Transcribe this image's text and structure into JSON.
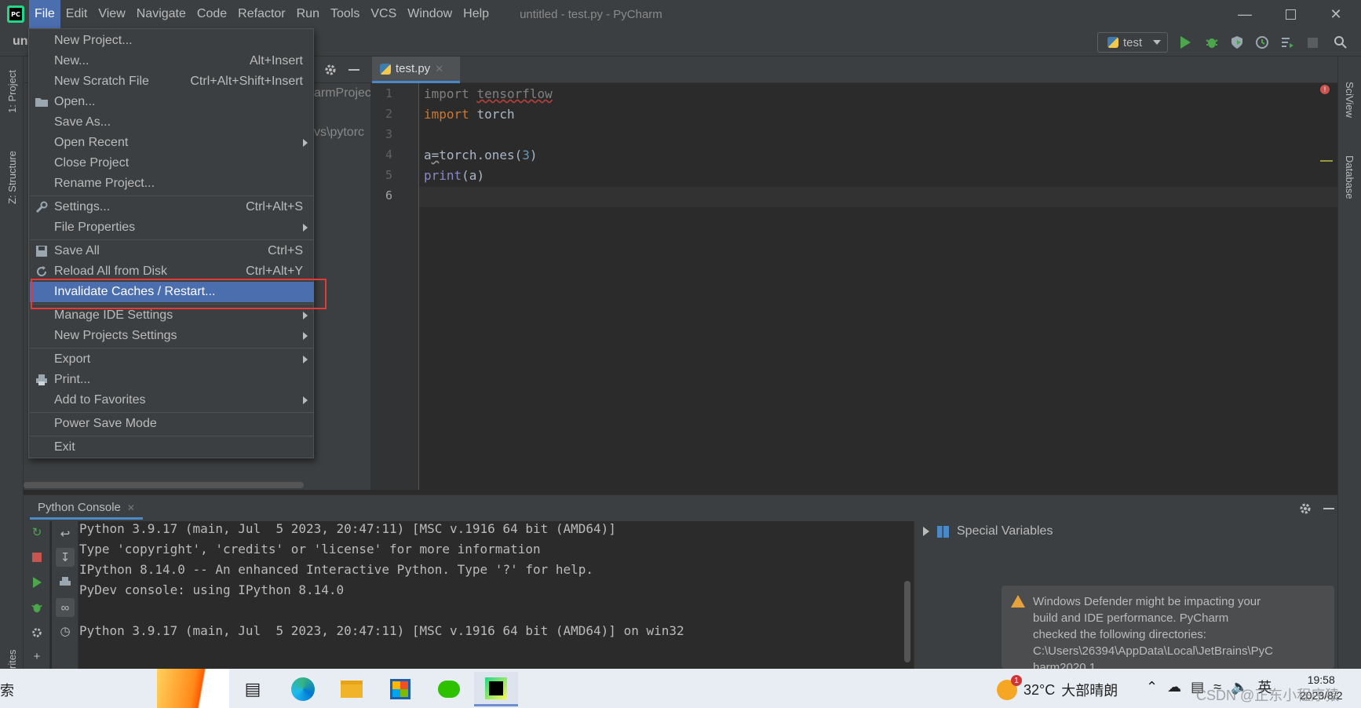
{
  "menubar": {
    "items": [
      "File",
      "Edit",
      "View",
      "Navigate",
      "Code",
      "Refactor",
      "Run",
      "Tools",
      "VCS",
      "Window",
      "Help"
    ],
    "window_title": "untitled - test.py - PyCharm"
  },
  "navbar": {
    "project_crumb": "unt",
    "run_config": "test"
  },
  "left_strip": {
    "project_tab": "1: Project",
    "structure_tab": "Z: Structure",
    "favorites_tab": "rites"
  },
  "right_strip": {
    "sciview_tab": "SciView",
    "database_tab": "Database"
  },
  "project_pane": {
    "row1_partial": "armProjec",
    "row2_partial": "vs\\pytorc"
  },
  "editor": {
    "tab_label": "test.py",
    "line_numbers": [
      "1",
      "2",
      "3",
      "4",
      "5",
      "6"
    ],
    "lines": {
      "l1_kw": "import",
      "l1_mod": "tensorflow",
      "l2_kw": "import",
      "l2_mod": "torch",
      "l4_pre": "a",
      "l4_eq": "=",
      "l4_mid": "torch.ones(",
      "l4_num": "3",
      "l4_end": ")",
      "l5_fn": "print",
      "l5_arg": "(a)"
    }
  },
  "file_menu": {
    "items": [
      {
        "label": "New Project...",
        "shortcut": ""
      },
      {
        "label": "New...",
        "shortcut": "Alt+Insert"
      },
      {
        "label": "New Scratch File",
        "shortcut": "Ctrl+Alt+Shift+Insert"
      },
      {
        "label": "Open...",
        "shortcut": ""
      },
      {
        "label": "Save As...",
        "shortcut": ""
      },
      {
        "label": "Open Recent",
        "shortcut": ""
      },
      {
        "label": "Close Project",
        "shortcut": ""
      },
      {
        "label": "Rename Project...",
        "shortcut": ""
      },
      {
        "label": "Settings...",
        "shortcut": "Ctrl+Alt+S"
      },
      {
        "label": "File Properties",
        "shortcut": ""
      },
      {
        "label": "Save All",
        "shortcut": "Ctrl+S"
      },
      {
        "label": "Reload All from Disk",
        "shortcut": "Ctrl+Alt+Y"
      },
      {
        "label": "Invalidate Caches / Restart...",
        "shortcut": ""
      },
      {
        "label": "Manage IDE Settings",
        "shortcut": ""
      },
      {
        "label": "New Projects Settings",
        "shortcut": ""
      },
      {
        "label": "Export",
        "shortcut": ""
      },
      {
        "label": "Print...",
        "shortcut": ""
      },
      {
        "label": "Add to Favorites",
        "shortcut": ""
      },
      {
        "label": "Power Save Mode",
        "shortcut": ""
      },
      {
        "label": "Exit",
        "shortcut": ""
      }
    ]
  },
  "console": {
    "tab_label": "Python Console",
    "lines": [
      "Python 3.9.17 (main, Jul  5 2023, 20:47:11) [MSC v.1916 64 bit (AMD64)]",
      "Type 'copyright', 'credits' or 'license' for more information",
      "IPython 8.14.0 -- An enhanced Interactive Python. Type '?' for help.",
      "PyDev console: using IPython 8.14.0",
      "Python 3.9.17 (main, Jul  5 2023, 20:47:11) [MSC v.1916 64 bit (AMD64)] on win32"
    ],
    "special_variables": "Special Variables"
  },
  "notification": {
    "lines": [
      "Windows Defender might be impacting your",
      "build and IDE performance. PyCharm",
      "checked the following directories:",
      "C:\\Users\\26394\\AppData\\Local\\JetBrains\\PyC",
      "harm2020.1"
    ]
  },
  "taskbar": {
    "search_partial": "索",
    "weather_badge": "1",
    "weather_temp": "32°C",
    "weather_desc": "大部晴朗",
    "ime": "英",
    "time": "19:58",
    "date": "2023/8/2",
    "watermark": "CSDN @正东小程序猿"
  },
  "colors": {
    "menu_selected": "#4b6eaf",
    "highlight_box": "#e53935",
    "keyword": "#cc7832",
    "run_green": "#4ca64c"
  }
}
